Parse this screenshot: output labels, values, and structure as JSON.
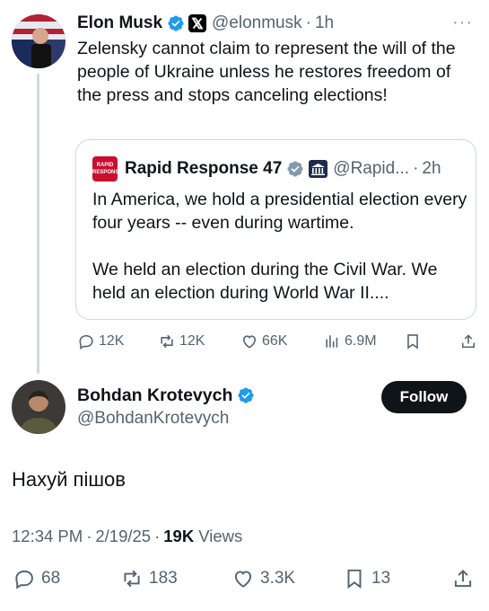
{
  "parent_tweet": {
    "author_name": "Elon Musk",
    "handle": "@elonmusk",
    "separator": "·",
    "time": "1h",
    "more": "···",
    "text": "Zelensky cannot claim to represent the will of the people of Ukraine unless he restores freedom of the press and stops canceling elections!",
    "quote": {
      "logo_text": "RAPID RESPONSE",
      "author_name": "Rapid Response 47",
      "handle": "@Rapid...",
      "separator": "·",
      "time": "2h",
      "line1": "In America, we hold a presidential election every four years -- even during wartime.",
      "line2": "We held an election during the Civil War. We held an election during World War II...."
    },
    "actions": {
      "replies": "12K",
      "reposts": "12K",
      "likes": "66K",
      "views": "6.9M"
    }
  },
  "reply": {
    "author_name": "Bohdan Krotevych",
    "handle": "@BohdanKrotevych",
    "follow_label": "Follow",
    "text": "Нахуй пішов",
    "time": "12:34 PM",
    "separator": "·",
    "date": "2/19/25",
    "views_count": "19K",
    "views_label": "Views",
    "actions": {
      "replies": "68",
      "reposts": "183",
      "likes": "3.3K",
      "bookmarks": "13"
    }
  },
  "colors": {
    "verified_blue": "#1d9bf0",
    "secondary_text": "#536471",
    "gov_gray": "#829aab",
    "follow_bg": "#0f1419"
  }
}
